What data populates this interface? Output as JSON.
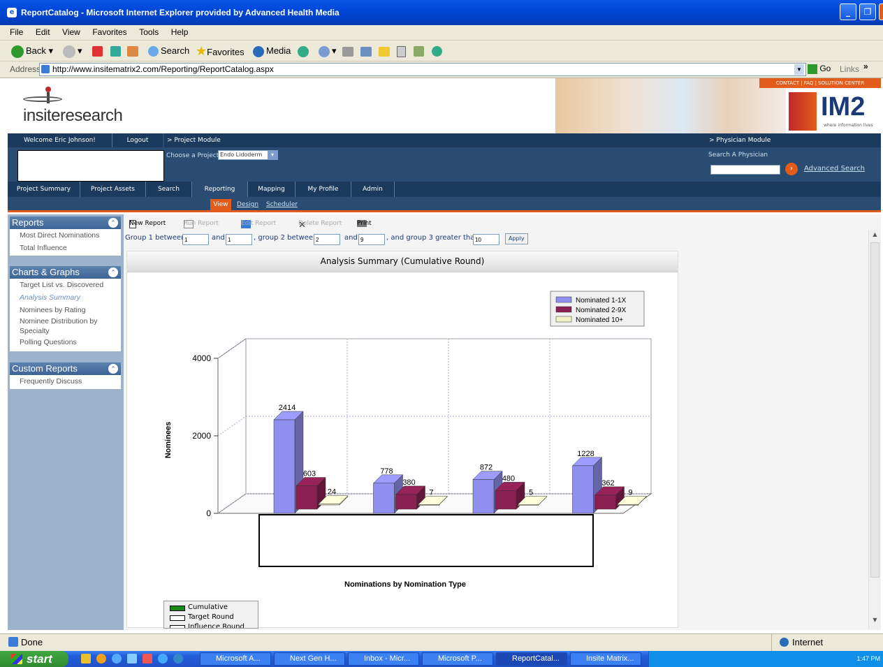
{
  "window": {
    "title": "ReportCatalog - Microsoft Internet Explorer provided by Advanced Health Media"
  },
  "menu": [
    "File",
    "Edit",
    "View",
    "Favorites",
    "Tools",
    "Help"
  ],
  "toolbar": {
    "back": "Back",
    "search": "Search",
    "favorites": "Favorites",
    "media": "Media"
  },
  "address": {
    "label": "Address",
    "url": "http://www.insitematrix2.com/Reporting/ReportCatalog.aspx",
    "go": "Go",
    "links": "Links"
  },
  "header": {
    "logo": "insiteresearch",
    "brand": "IM2",
    "brand_tagline": "where information lives",
    "top_links": "CONTACT | FAQ | SOLUTION CENTER"
  },
  "nav": {
    "welcome": "Welcome Eric Johnson!",
    "logout": "Logout",
    "project_module": "> Project Module",
    "choose_project": "Choose a Project:",
    "project_value": "Endo Lidoderm",
    "physician_module": "> Physician Module",
    "search_physician": "Search A Physician",
    "advanced_search": "Advanced Search"
  },
  "tabs": [
    "Project Summary",
    "Project Assets",
    "Search",
    "Reporting",
    "Mapping",
    "My Profile",
    "Admin"
  ],
  "subtabs": [
    "View",
    "Design",
    "Scheduler"
  ],
  "sidebar": {
    "reports_title": "Reports",
    "reports": [
      "Most Direct Nominations",
      "Total Influence"
    ],
    "charts_title": "Charts & Graphs",
    "charts": [
      "Target List vs. Discovered",
      "Analysis Summary",
      "Nominees by Rating",
      "Nominee Distribution by",
      "Specialty",
      "Polling Questions"
    ],
    "custom_title": "Custom Reports",
    "custom": [
      "Frequently Discuss"
    ]
  },
  "report_toolbar": [
    "New Report",
    "Run Report",
    "Edit Report",
    "Delete Report",
    "Print"
  ],
  "filters": {
    "g1_label": "Group 1 between",
    "g1_from": "1",
    "and1": "and",
    "g1_to": "1",
    "g2_label": ", group 2 between",
    "g2_from": "2",
    "and2": "and",
    "g2_to": "9",
    "g3_label": ", and group 3 greater than",
    "g3_value": "10",
    "apply": "Apply"
  },
  "chart_data": {
    "type": "bar",
    "title": "Analysis Summary (Cumulative Round)",
    "xlabel": "Nominations by Nomination Type",
    "ylabel": "Nominees",
    "ylim": [
      0,
      4000
    ],
    "yticks": [
      "0",
      "2000",
      "4000"
    ],
    "categories": [
      "",
      "",
      "",
      ""
    ],
    "series": [
      {
        "name": "Nominated 1-1X",
        "color": "#8f8fef",
        "values": [
          2414,
          778,
          872,
          1228
        ]
      },
      {
        "name": "Nominated 2-9X",
        "color": "#8a1f52",
        "values": [
          603,
          380,
          480,
          362
        ]
      },
      {
        "name": "Nominated 10+",
        "color": "#f2f2c8",
        "values": [
          24,
          7,
          5,
          9
        ]
      }
    ],
    "data_labels": [
      [
        "2414",
        "603",
        "24"
      ],
      [
        "778",
        "380",
        "7"
      ],
      [
        "872",
        "480",
        "5"
      ],
      [
        "1228",
        "362",
        "9"
      ]
    ],
    "legend": "top-right",
    "grid": true
  },
  "round_legend": [
    "Cumulative",
    "Target Round",
    "Influence Round"
  ],
  "status": {
    "text": "Done",
    "zone": "Internet"
  },
  "taskbar": {
    "start": "start",
    "tasks": [
      "Microsoft A...",
      "Next Gen H...",
      "Inbox - Micr...",
      "Microsoft P...",
      "ReportCatal...",
      "Insite Matrix..."
    ],
    "clock": "1:47 PM"
  }
}
